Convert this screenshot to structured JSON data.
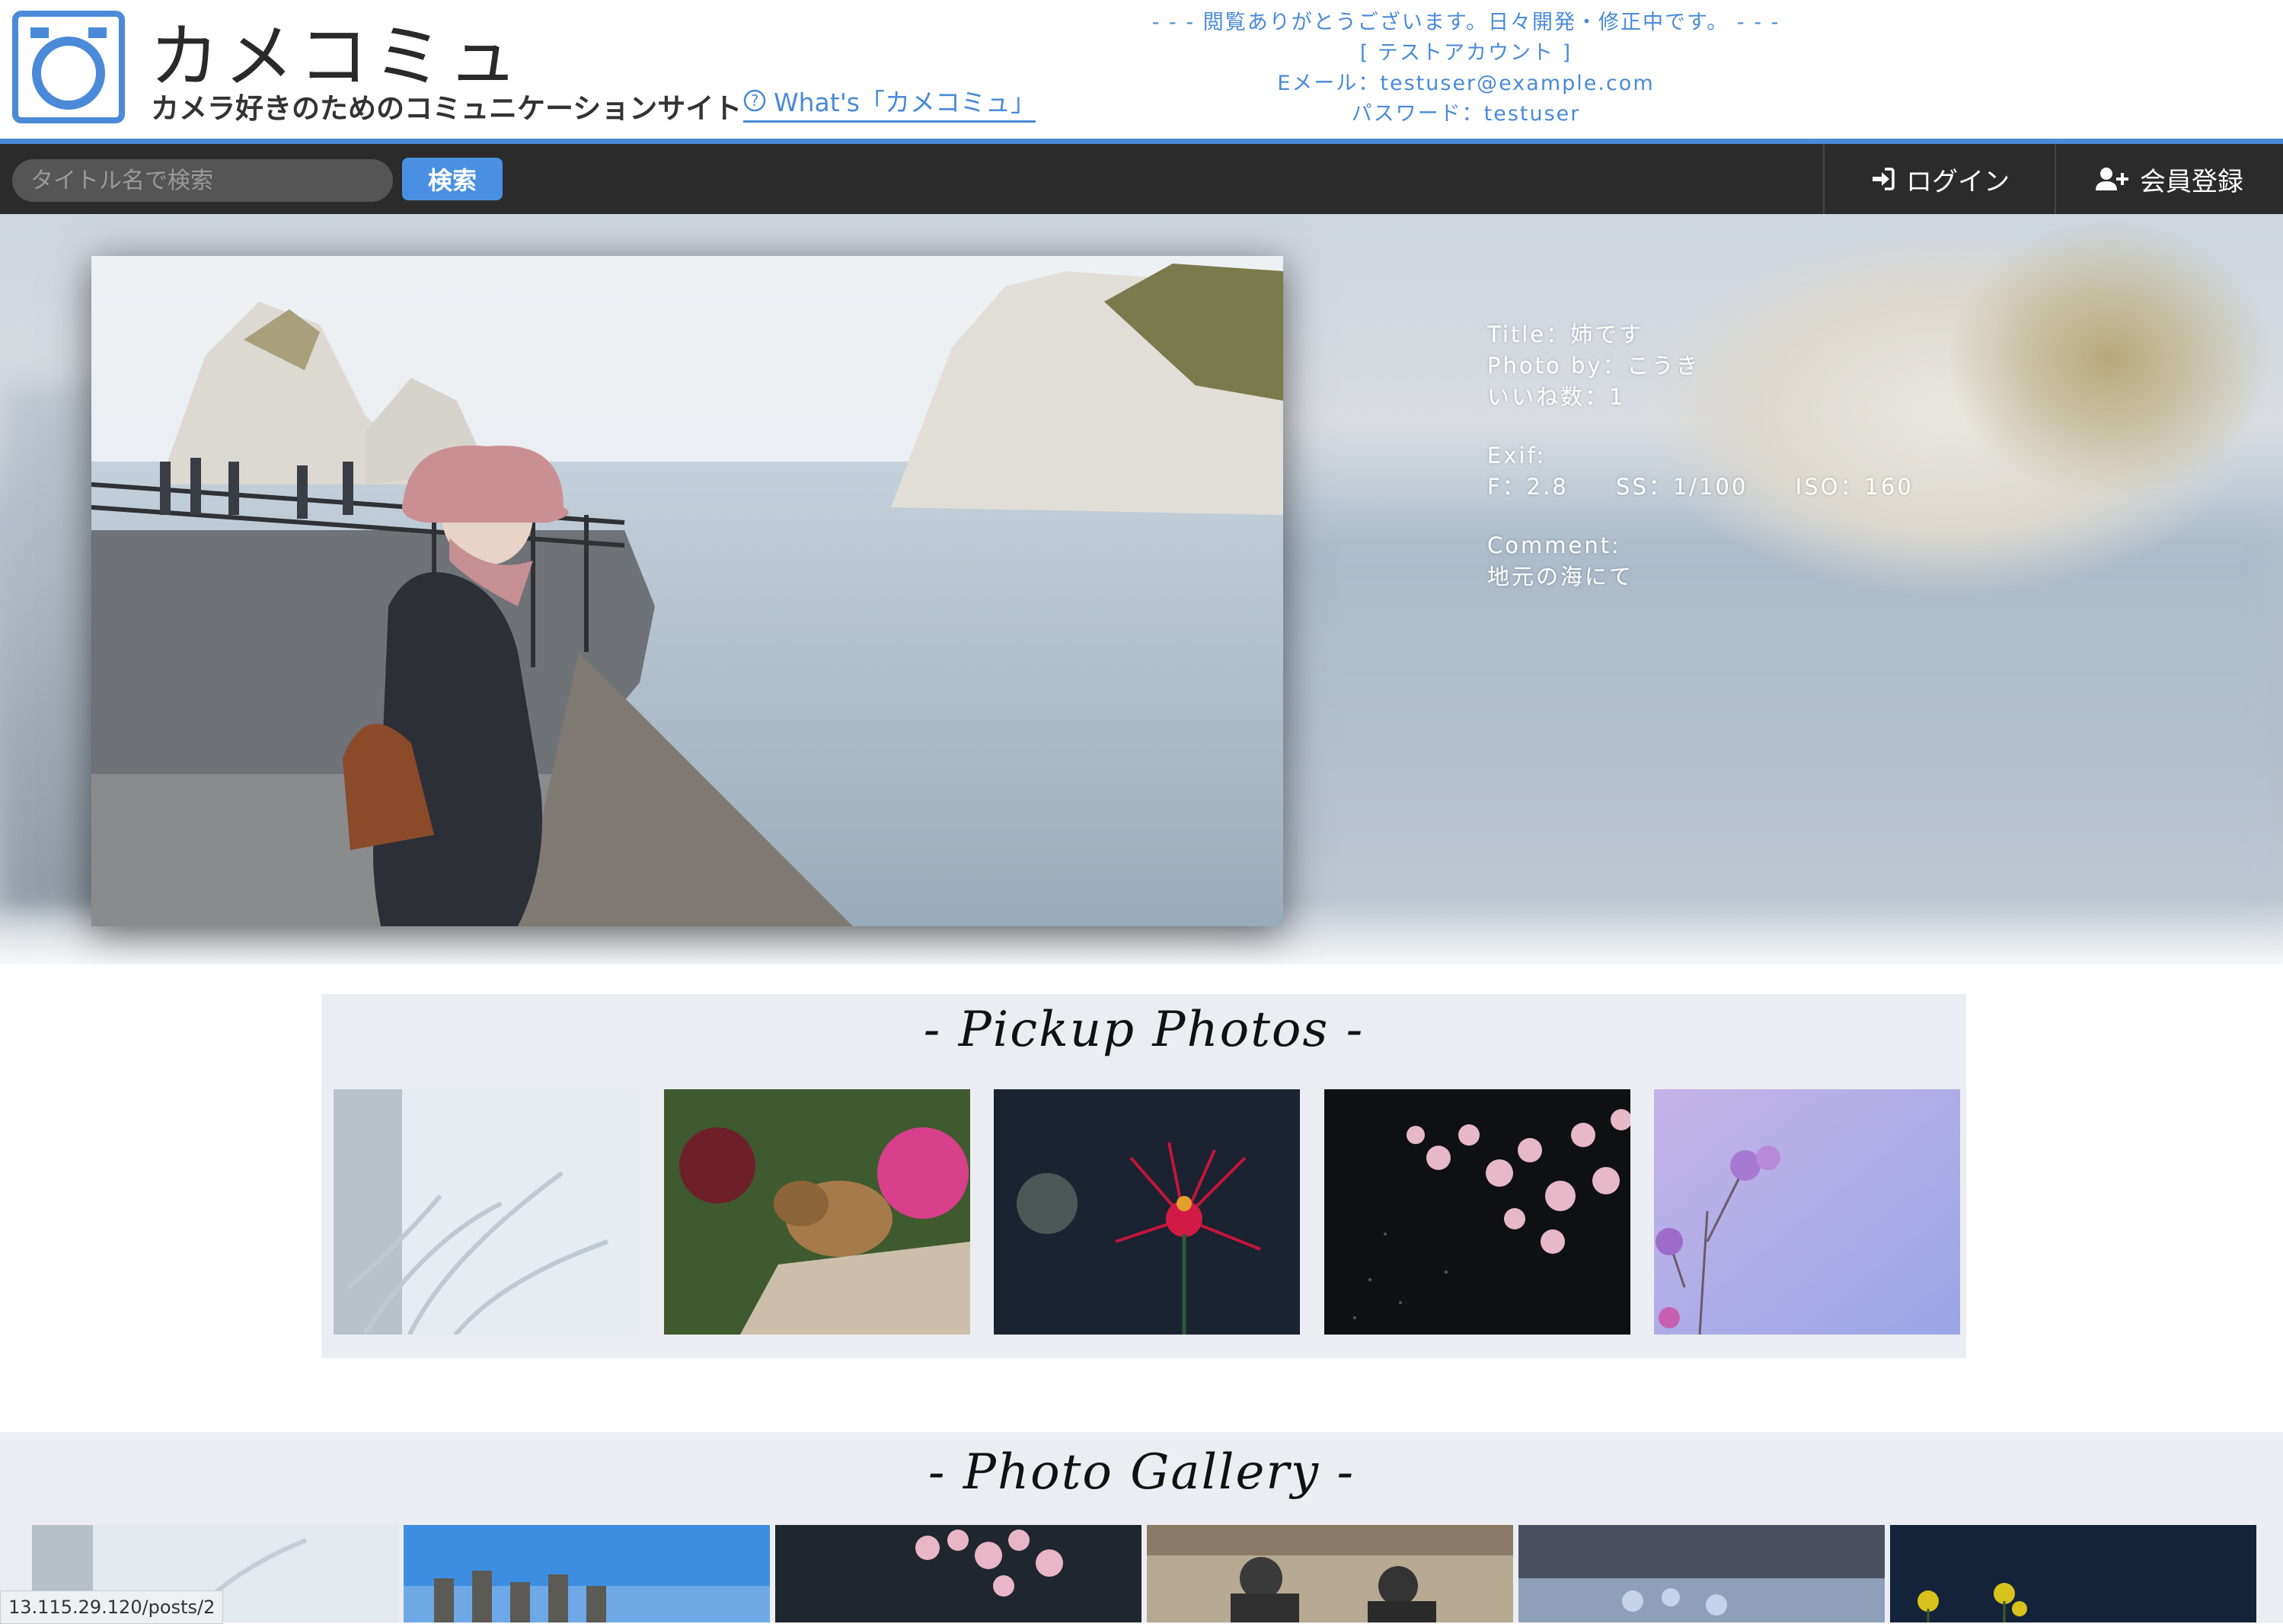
{
  "header": {
    "site_title": "カメコミュ",
    "tagline": "カメラ好きのためのコミュニケーションサイト",
    "whats_link": "What's「カメコミュ」",
    "notice": {
      "line1": "- - - 閲覧ありがとうございます。日々開発・修正中です。 - - -",
      "line2": "[ テストアカウント ]",
      "line3": "Eメール：testuser@example.com",
      "line4": "パスワード：testuser"
    },
    "accent_color": "#4a8ad8"
  },
  "nav": {
    "search_placeholder": "タイトル名で検索",
    "search_button": "検索",
    "login": "ログイン",
    "register": "会員登録"
  },
  "featured": {
    "title_label": "Title：",
    "title": "姉です",
    "photographer_label": "Photo by：",
    "photographer": "こうき",
    "likes_label": "いいね数：",
    "likes": "1",
    "exif_label": "Exif:",
    "f_value": "F：2.8",
    "ss_value": "SS：1/100",
    "iso_value": "ISO：160",
    "comment_label": "Comment:",
    "comment": "地元の海にて"
  },
  "pickup": {
    "title": "- Pickup Photos -"
  },
  "gallery": {
    "title": "- Photo Gallery -"
  },
  "status_bar": {
    "url": "13.115.29.120/posts/2"
  }
}
